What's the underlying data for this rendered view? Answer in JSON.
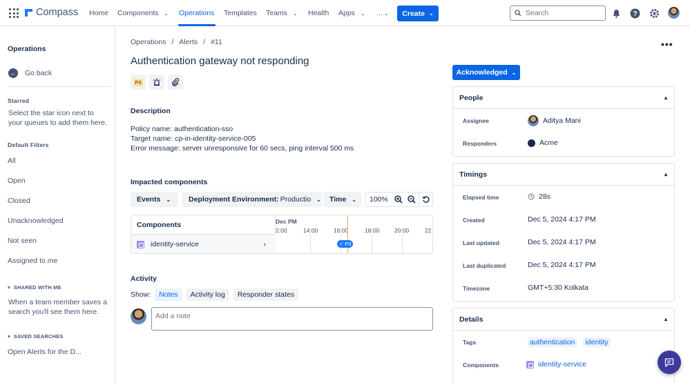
{
  "topnav": {
    "brand": "Compass",
    "links": [
      "Home",
      "Components",
      "Operations",
      "Templates",
      "Teams",
      "Health",
      "Apps",
      "..."
    ],
    "create_label": "Create",
    "search_placeholder": "Search",
    "accent_color": "#0c66e4"
  },
  "sidebar": {
    "title": "Operations",
    "go_back": "Go back",
    "starred_heading": "Starred",
    "starred_help": "Select the star icon next to your queues to add them here.",
    "default_filters_heading": "Default Filters",
    "filters": [
      "All",
      "Open",
      "Closed",
      "Unacknowledged",
      "Not seen",
      "Assigned to me"
    ],
    "shared_heading": "SHARED WITH ME",
    "shared_help": "When a team member saves a search you'll see them here.",
    "saved_heading": "SAVED SEARCHES",
    "saved_items": [
      "Open Alerts for the D..."
    ]
  },
  "breadcrumbs": [
    "Operations",
    "Alerts",
    "#11"
  ],
  "alert": {
    "title": "Authentication gateway not responding",
    "priority": "P3",
    "description_heading": "Description",
    "description_lines": [
      "Policy name: authentication-sso",
      "Target name: cp-in-identity-service-005",
      "Error message: server unresponsive for 60 secs, ping interval 500 ms"
    ]
  },
  "impacted": {
    "heading": "Impacted components",
    "filters": {
      "events": "Events",
      "deployment": "Deployment Environment:",
      "deployment_value": "Productio",
      "time": "Time"
    },
    "zoom": "100%",
    "timeline": {
      "components_heading": "Components",
      "month_label": "Dec PM",
      "ticks": [
        "2:00",
        "14:00",
        "16:00",
        "18:00",
        "20:00",
        "22"
      ],
      "component": "identity-service",
      "marker_label": "P3"
    }
  },
  "activity": {
    "heading": "Activity",
    "show_label": "Show:",
    "tabs": [
      "Notes",
      "Activity log",
      "Responder states"
    ],
    "note_placeholder": "Add a note"
  },
  "status_button": "Acknowledged",
  "people": {
    "heading": "People",
    "assignee_label": "Assignee",
    "assignee": "Aditya Mani",
    "responders_label": "Responders",
    "responders": "Acme"
  },
  "timings": {
    "heading": "Timings",
    "rows": [
      {
        "label": "Elapsed time",
        "value": "28s"
      },
      {
        "label": "Created",
        "value": "Dec 5, 2024 4:17 PM"
      },
      {
        "label": "Last updated",
        "value": "Dec 5, 2024 4:17 PM"
      },
      {
        "label": "Last duplicated",
        "value": "Dec 5, 2024 4:17 PM"
      },
      {
        "label": "Timezone",
        "value": "GMT+5:30 Kolkata"
      }
    ]
  },
  "details": {
    "heading": "Details",
    "tags_label": "Tags",
    "tags": [
      "authentication",
      "identity"
    ],
    "components_label": "Components",
    "component": "identity-service"
  }
}
